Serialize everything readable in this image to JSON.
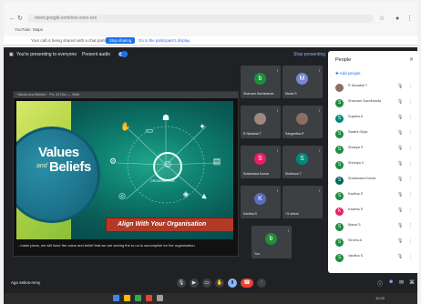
{
  "browser": {
    "address": "meet.google.com/xxx-xxxx-xxx",
    "bookmarks": [
      "YouTube",
      "Maps"
    ],
    "notice_text": "Your call is being shared with a chat participant",
    "notice_button": "Stop sharing",
    "notice_link": "Go to the participant's display"
  },
  "meet": {
    "presenting_label": "You're presenting to everyone",
    "transcription_label": "Present audio",
    "stop_presenting": "Stop presenting",
    "presentation_title": "Values and Beliefs ~ Fri, 12 Dec — Slide",
    "slide": {
      "values": "Values",
      "and": "and",
      "beliefs": "Beliefs",
      "hub_label": "ORGANISATION",
      "align_text": "Align With Your Organisation"
    },
    "caption": "...make plans, we will have the value and belief that we are seeing the to us to accomplish for the organisation.",
    "tiles": [
      {
        "initial": "b",
        "name": "Sharvani Sachinanda",
        "color": "#1e8e3e"
      },
      {
        "initial": "M",
        "name": "Mansi S",
        "color": "#7986cb"
      },
      {
        "initial": "",
        "name": "R Nanabai T",
        "color": "#a1887f"
      },
      {
        "initial": "",
        "name": "Sangeetha R",
        "color": "#8d6e63"
      },
      {
        "initial": "S",
        "name": "Sudarsana Kumar",
        "color": "#e91e63"
      },
      {
        "initial": "S",
        "name": "Sindhuva T",
        "color": "#00897b"
      },
      {
        "initial": "K",
        "name": "Kavitha S",
        "color": "#5c6bc0"
      },
      {
        "initial": "",
        "name": "+3 others",
        "color": "#3c4043"
      },
      {
        "initial": "b",
        "name": "You",
        "color": "#1e8e3e"
      }
    ],
    "meet_code": "Ago sekos-mmy",
    "bottom_controls": [
      "mic-icon",
      "camera-icon",
      "captions-icon",
      "raise-hand-icon",
      "present-icon",
      "more-icon"
    ]
  },
  "people": {
    "title": "People",
    "add_people": "Add people",
    "rows": [
      {
        "initial": "",
        "name": "R Nanabai T",
        "color": "#8d6e63"
      },
      {
        "initial": "S",
        "name": "Sharvani Sachinanda",
        "color": "#1e8e3e"
      },
      {
        "initial": "S",
        "name": "Sujatha A",
        "color": "#00897b"
      },
      {
        "initial": "S",
        "name": "Swathi Girija",
        "color": "#1e8e3e"
      },
      {
        "initial": "S",
        "name": "Shraiya S",
        "color": "#1e8e3e"
      },
      {
        "initial": "S",
        "name": "Shriniya V",
        "color": "#1e8e3e"
      },
      {
        "initial": "S",
        "name": "Sudarsana Kumar",
        "color": "#00695c"
      },
      {
        "initial": "S",
        "name": "Kavitha S",
        "color": "#1e8e3e"
      },
      {
        "initial": "K",
        "name": "Kavitha S",
        "color": "#e91e63"
      },
      {
        "initial": "S",
        "name": "Mansi S",
        "color": "#1e8e3e"
      },
      {
        "initial": "S",
        "name": "Sindhu A",
        "color": "#1e8e3e"
      },
      {
        "initial": "S",
        "name": "Vanitha S",
        "color": "#1e8e3e"
      }
    ]
  },
  "taskbar": {
    "time": "11:03"
  }
}
